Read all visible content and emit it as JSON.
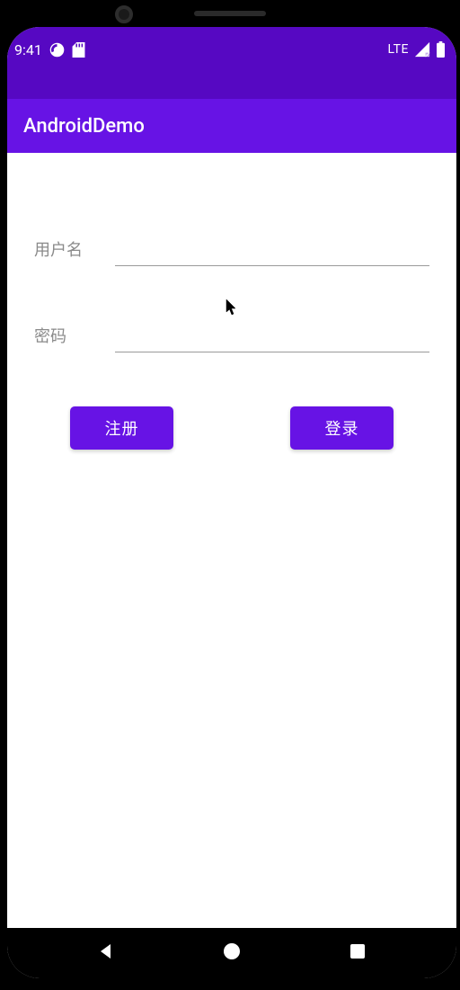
{
  "status_bar": {
    "clock": "9:41",
    "network_label": "LTE"
  },
  "app_bar": {
    "title": "AndroidDemo"
  },
  "form": {
    "username_label": "用户名",
    "username_value": "",
    "password_label": "密码",
    "password_value": ""
  },
  "buttons": {
    "register_label": "注册",
    "login_label": "登录"
  },
  "colors": {
    "status_bar_bg": "#5608C2",
    "app_bar_bg": "#6713E5",
    "button_bg": "#6713E5",
    "label_text": "#8a8a8a"
  }
}
